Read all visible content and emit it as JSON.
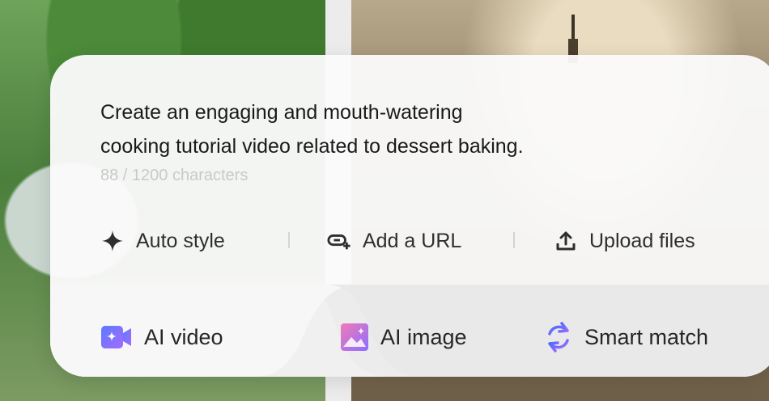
{
  "prompt": {
    "line1": "Create an engaging and mouth-watering",
    "line2": "cooking tutorial video related to dessert baking.",
    "counter": "88 / 1200 characters"
  },
  "toolbar": {
    "auto_style": {
      "label": "Auto style",
      "icon": "sparkle-icon"
    },
    "add_url": {
      "label": "Add a URL",
      "icon": "link-add-icon"
    },
    "upload": {
      "label": "Upload files",
      "icon": "upload-icon"
    }
  },
  "tabs": {
    "ai_video": {
      "label": "AI video",
      "icon": "video-camera-sparkle-icon"
    },
    "ai_image": {
      "label": "AI image",
      "icon": "image-icon"
    },
    "smart_match": {
      "label": "Smart match",
      "icon": "refresh-icon"
    }
  },
  "colors": {
    "accent_purple": "#7b61ff",
    "accent_blue": "#4b6bff",
    "counter_grey": "#c9c9c9",
    "text": "#1a1a1a"
  }
}
